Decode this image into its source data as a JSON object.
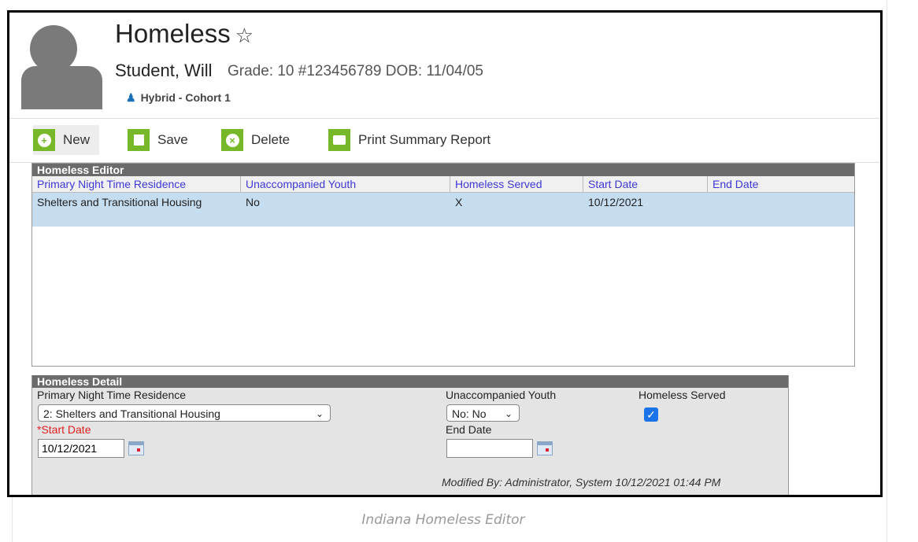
{
  "header": {
    "title": "Homeless",
    "star_icon": "☆",
    "student_name": "Student, Will",
    "student_meta": "Grade: 10 #123456789 DOB: 11/04/05",
    "cohort": "Hybrid - Cohort 1"
  },
  "toolbar": {
    "new_label": "New",
    "save_label": "Save",
    "delete_label": "Delete",
    "print_label": "Print Summary Report"
  },
  "editor": {
    "title": "Homeless Editor",
    "columns": [
      "Primary Night Time Residence",
      "Unaccompanied Youth",
      "Homeless Served",
      "Start Date",
      "End Date"
    ],
    "rows": [
      {
        "residence": "Shelters and Transitional Housing",
        "youth": "No",
        "served": "X",
        "start": "10/12/2021",
        "end": ""
      }
    ]
  },
  "detail": {
    "title": "Homeless Detail",
    "residence_label": "Primary Night Time Residence",
    "residence_value": "2: Shelters and Transitional Housing",
    "youth_label": "Unaccompanied Youth",
    "youth_value": "No: No",
    "served_label": "Homeless Served",
    "served_checked": true,
    "start_label": "*Start Date",
    "start_value": "10/12/2021",
    "end_label": "End Date",
    "end_value": "",
    "modified": "Modified By: Administrator, System 10/12/2021 01:44 PM"
  },
  "caption": "Indiana Homeless Editor",
  "colors": {
    "accent_green": "#77b82a",
    "column_header_text": "#3e38d8",
    "selected_row": "#c6dcef",
    "required_label": "#e02020"
  }
}
